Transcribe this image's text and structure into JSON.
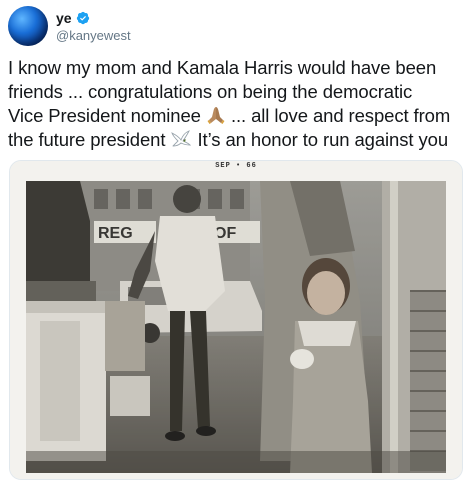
{
  "user": {
    "display_name": "ye",
    "handle": "@kanyewest",
    "avatar_icon": "globe-avatar",
    "verified_icon": "verified-badge-icon",
    "verified_color": "#1da1f2"
  },
  "tweet": {
    "line1": "I know my mom and Kamala Harris would have been",
    "line2": "friends ... congratulations on being the democratic",
    "line3_a": "Vice President nominee",
    "line3_b": "... all love and respect from",
    "line4_a": "the future president",
    "line4_b": "It’s an honor to run against you",
    "emoji_1": "folded-hands-emoji",
    "emoji_2": "dove-emoji"
  },
  "photo": {
    "stamp": "SEP  •  66",
    "sign_text": "REG",
    "sign_text_2": "OF"
  }
}
